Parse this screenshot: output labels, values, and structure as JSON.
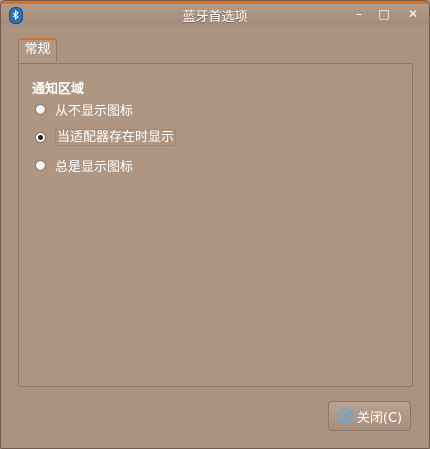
{
  "window": {
    "title": "蓝牙首选项",
    "controls": {
      "minimize": "–",
      "maximize": "□",
      "close": "✕"
    }
  },
  "tabs": [
    {
      "label": "常规"
    }
  ],
  "section": {
    "title": "通知区域"
  },
  "options": [
    {
      "label": "从不显示图标",
      "checked": false
    },
    {
      "label": "当适配器存在时显示",
      "checked": true
    },
    {
      "label": "总是显示图标",
      "checked": false
    }
  ],
  "buttons": {
    "close_label": "关闭(C)"
  },
  "colors": {
    "window_bg": "#ab9381",
    "accent": "#e36f1b",
    "close_icon": "#67a9d8"
  }
}
